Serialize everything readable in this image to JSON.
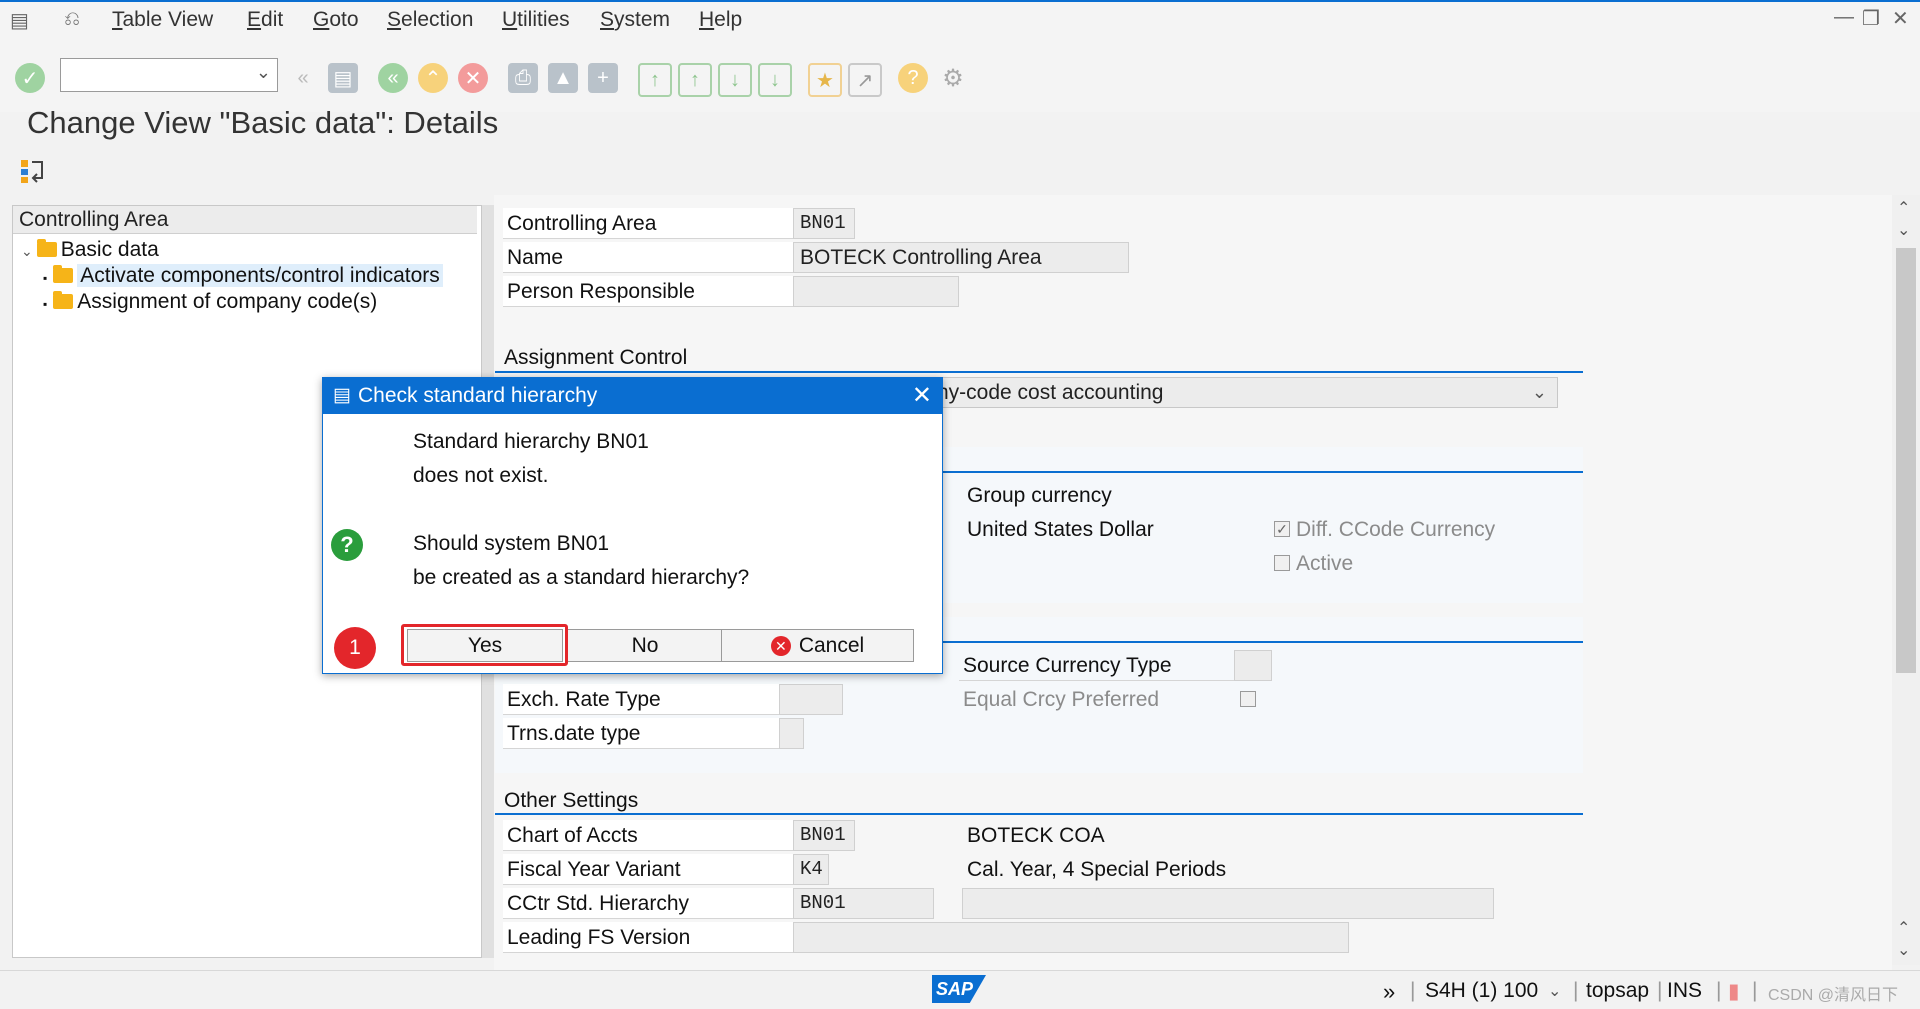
{
  "menu": {
    "items": [
      "Table View",
      "Edit",
      "Goto",
      "Selection",
      "Utilities",
      "System",
      "Help"
    ]
  },
  "page": {
    "title": "Change View \"Basic data\": Details"
  },
  "tree": {
    "header": "Controlling Area",
    "root": "Basic data",
    "children": [
      "Activate components/control indicators",
      "Assignment of company code(s)"
    ]
  },
  "header_fields": {
    "controlling_area": {
      "label": "Controlling Area",
      "value": "BN01"
    },
    "name": {
      "label": "Name",
      "value": "BOTECK Controlling Area"
    },
    "person_responsible": {
      "label": "Person Responsible",
      "value": ""
    }
  },
  "assignment_control": {
    "title": "Assignment Control",
    "dropdown_value": "ny-code cost accounting"
  },
  "currency": {
    "group_currency_label": "Group currency",
    "group_currency_value": "United States Dollar",
    "diff_ccode_label": "Diff. CCode Currency",
    "active_label": "Active"
  },
  "exchange": {
    "exch_rate_type": "Exch. Rate Type",
    "trns_date_type": "Trns.date type",
    "source_currency_type": "Source Currency Type",
    "equal_crcy_preferred": "Equal Crcy Preferred"
  },
  "other_settings": {
    "title": "Other Settings",
    "chart_of_accts": {
      "label": "Chart of Accts",
      "value": "BN01",
      "desc": "BOTECK COA"
    },
    "fiscal_year_variant": {
      "label": "Fiscal Year Variant",
      "value": "K4",
      "desc": "Cal. Year, 4 Special Periods"
    },
    "cctr_std_hierarchy": {
      "label": "CCtr Std. Hierarchy",
      "value": "BN01",
      "desc": ""
    },
    "leading_fs_version": {
      "label": "Leading FS Version",
      "value": ""
    }
  },
  "dialog": {
    "title": "Check standard hierarchy",
    "line1": "Standard hierarchy BN01",
    "line2": "does not exist.",
    "line3": "Should system BN01",
    "line4": "be created as a standard hierarchy?",
    "yes": "Yes",
    "no": "No",
    "cancel": "Cancel",
    "step_badge": "1"
  },
  "status": {
    "system": "S4H (1) 100",
    "user": "topsap",
    "mode": "INS",
    "watermark": "CSDN @清风日下"
  },
  "colors": {
    "accent": "#0a6ed1",
    "highlight_red": "#e3262b"
  }
}
